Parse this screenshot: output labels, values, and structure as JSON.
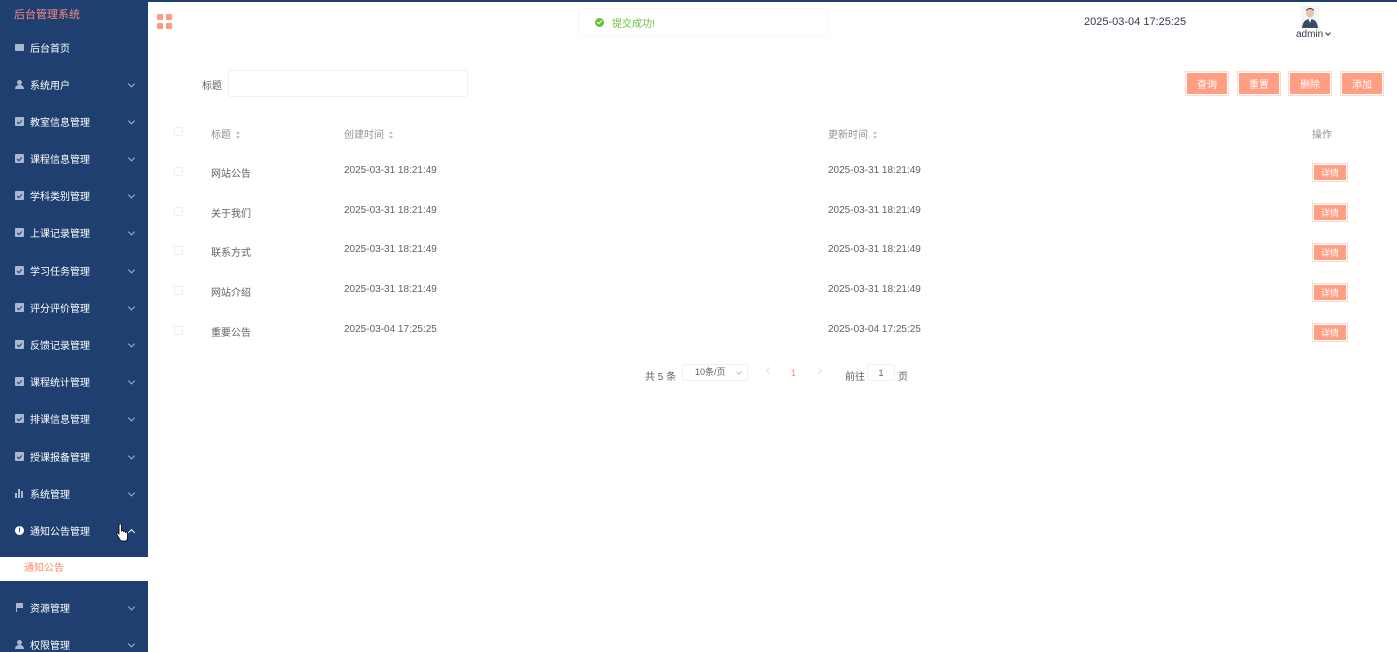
{
  "sidebar": {
    "brand": "后台管理系统",
    "items": [
      {
        "label": "后台首页",
        "icon": "monitor-icon"
      },
      {
        "label": "系统用户",
        "icon": "user-icon"
      },
      {
        "label": "教室信息管理",
        "icon": "check-square-icon"
      },
      {
        "label": "课程信息管理",
        "icon": "check-square-icon"
      },
      {
        "label": "学科类别管理",
        "icon": "check-square-icon"
      },
      {
        "label": "上课记录管理",
        "icon": "check-square-icon"
      },
      {
        "label": "学习任务管理",
        "icon": "check-square-icon"
      },
      {
        "label": "评分评价管理",
        "icon": "check-square-icon"
      },
      {
        "label": "反馈记录管理",
        "icon": "check-square-icon"
      },
      {
        "label": "课程统计管理",
        "icon": "check-square-icon"
      },
      {
        "label": "排课信息管理",
        "icon": "check-square-icon"
      },
      {
        "label": "授课报备管理",
        "icon": "check-square-icon"
      },
      {
        "label": "系统管理",
        "icon": "bar-chart-icon"
      },
      {
        "label": "通知公告管理",
        "icon": "info-icon"
      },
      {
        "label": "资源管理",
        "icon": "flag-icon"
      },
      {
        "label": "权限管理",
        "icon": "user-icon"
      }
    ],
    "sub_item": "通知公告"
  },
  "header": {
    "toast": "提交成功!",
    "datetime": "2025-03-04 17:25:25",
    "username": "admin"
  },
  "search": {
    "label": "标题",
    "value": "",
    "placeholder": ""
  },
  "buttons": {
    "query": "查询",
    "reset": "重置",
    "delete": "删除",
    "add": "添加"
  },
  "table": {
    "headers": {
      "title": "标题",
      "created": "创建时间",
      "updated": "更新时间",
      "actions": "操作"
    },
    "rows": [
      {
        "title": "网站公告",
        "created": "2025-03-31 18:21:49",
        "updated": "2025-03-31 18:21:49",
        "action": "详情"
      },
      {
        "title": "关于我们",
        "created": "2025-03-31 18:21:49",
        "updated": "2025-03-31 18:21:49",
        "action": "详情"
      },
      {
        "title": "联系方式",
        "created": "2025-03-31 18:21:49",
        "updated": "2025-03-31 18:21:49",
        "action": "详情"
      },
      {
        "title": "网站介绍",
        "created": "2025-03-31 18:21:49",
        "updated": "2025-03-31 18:21:49",
        "action": "详情"
      },
      {
        "title": "重要公告",
        "created": "2025-03-04 17:25:25",
        "updated": "2025-03-04 17:25:25",
        "action": "详情"
      }
    ]
  },
  "pagination": {
    "total": "共 5 条",
    "page_size": "10条/页",
    "current": "1",
    "goto_label": "前往",
    "goto_value": "1",
    "page_suffix": "页"
  },
  "colors": {
    "sidebar_bg": "#1e3f6f",
    "accent": "#ff9e82",
    "success": "#67c23a"
  }
}
